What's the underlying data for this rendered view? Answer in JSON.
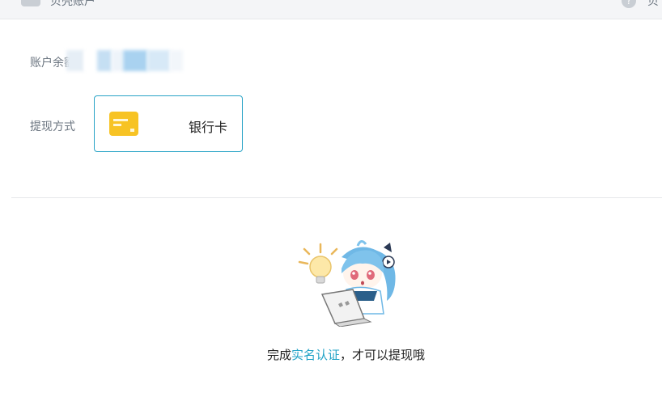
{
  "topbar": {
    "title": "贝壳账户",
    "help_icon": "question-circle-icon",
    "help_text": "贝"
  },
  "account": {
    "balance_label": "账户余额",
    "balance_value_obscured": true
  },
  "withdraw": {
    "method_label": "提现方式",
    "methods": [
      {
        "label": "银行卡",
        "icon": "bank-card-icon",
        "selected": true
      }
    ]
  },
  "notice": {
    "prefix": "完成",
    "link": "实名认证",
    "suffix": "，才可以提现哦"
  },
  "colors": {
    "accent": "#2aa4c7",
    "link": "#23a3c7",
    "card": "#f7c324",
    "label": "#6b7580"
  }
}
